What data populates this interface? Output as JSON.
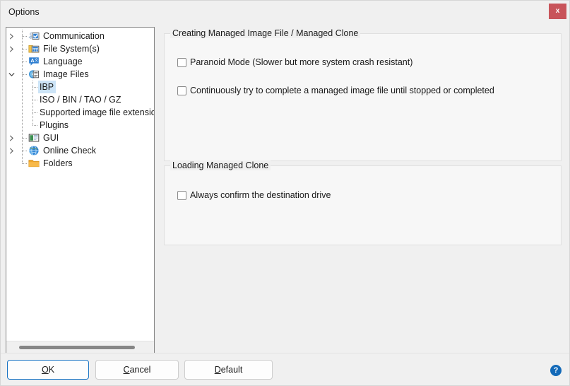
{
  "window": {
    "title": "Options",
    "close_label": "x"
  },
  "tree": {
    "items": [
      {
        "label": "Communication",
        "icon": "communication-gear-icon",
        "level": 0,
        "expander": "collapsed",
        "selected": false
      },
      {
        "label": "File System(s)",
        "icon": "file-system-folder-icon",
        "level": 0,
        "expander": "collapsed",
        "selected": false
      },
      {
        "label": "Language",
        "icon": "language-icon",
        "level": 0,
        "expander": "none",
        "selected": false
      },
      {
        "label": "Image Files",
        "icon": "image-files-disc-icon",
        "level": 0,
        "expander": "expanded",
        "selected": false
      },
      {
        "label": "IBP",
        "icon": "none",
        "level": 1,
        "expander": "none",
        "selected": true
      },
      {
        "label": "ISO / BIN / TAO / GZ",
        "icon": "none",
        "level": 1,
        "expander": "none",
        "selected": false
      },
      {
        "label": "Supported image file extension",
        "icon": "none",
        "level": 1,
        "expander": "none",
        "selected": false
      },
      {
        "label": "Plugins",
        "icon": "none",
        "level": 1,
        "expander": "none",
        "selected": false
      },
      {
        "label": "GUI",
        "icon": "gui-window-icon",
        "level": 0,
        "expander": "collapsed",
        "selected": false
      },
      {
        "label": "Online Check",
        "icon": "globe-icon",
        "level": 0,
        "expander": "collapsed",
        "selected": false
      },
      {
        "label": "Folders",
        "icon": "folder-icon",
        "level": 0,
        "expander": "none",
        "selected": false
      }
    ]
  },
  "panel": {
    "groups": [
      {
        "title": "Creating Managed Image File / Managed Clone",
        "checkboxes": [
          {
            "label": "Paranoid Mode (Slower but more system crash resistant)",
            "checked": false
          },
          {
            "label": "Continuously try to complete a managed image file until stopped or completed",
            "checked": false
          }
        ]
      },
      {
        "title": "Loading Managed Clone",
        "checkboxes": [
          {
            "label": "Always confirm the destination drive",
            "checked": false
          }
        ]
      }
    ]
  },
  "footer": {
    "ok": {
      "prefix": "",
      "mnemonic": "O",
      "suffix": "K"
    },
    "cancel": {
      "prefix": "",
      "mnemonic": "C",
      "suffix": "ancel"
    },
    "default": {
      "prefix": "",
      "mnemonic": "D",
      "suffix": "efault"
    },
    "help_label": "?"
  },
  "colors": {
    "accent": "#1269b8",
    "selection": "#cce4f7",
    "close_button": "#c8545a",
    "default_button_border": "#1a74c4"
  }
}
